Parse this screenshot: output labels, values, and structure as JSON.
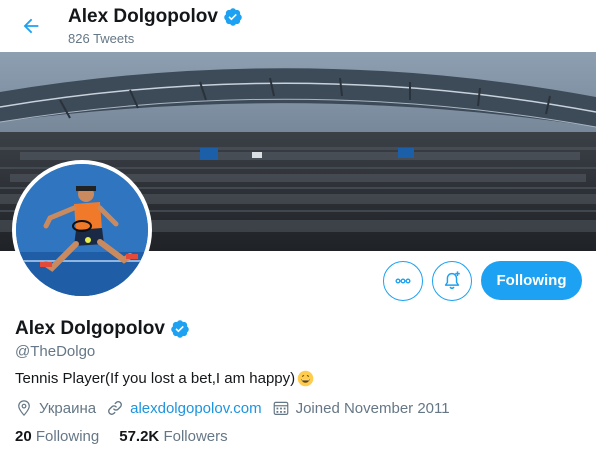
{
  "header": {
    "name": "Alex Dolgopolov",
    "tweet_count": "826 Tweets"
  },
  "profile": {
    "name": "Alex Dolgopolov",
    "handle": "@TheDolgo",
    "bio": "Tennis Player(If you lost a bet,I am happy)",
    "location": "Украина",
    "website": "alexdolgopolov.com",
    "joined": "Joined November 2011"
  },
  "actions": {
    "follow_label": "Following"
  },
  "stats": {
    "following_count": "20",
    "following_label": "Following",
    "followers_count": "57.2K",
    "followers_label": "Followers"
  },
  "icons": {
    "back": "arrow-left-icon",
    "verified": "verified-badge-icon",
    "more": "more-dots-icon",
    "notify": "bell-plus-icon",
    "location": "location-pin-icon",
    "link": "link-icon",
    "calendar": "calendar-icon"
  },
  "colors": {
    "accent": "#1da1f2",
    "link": "#1b95e0",
    "muted": "#657786",
    "text": "#14171a"
  }
}
